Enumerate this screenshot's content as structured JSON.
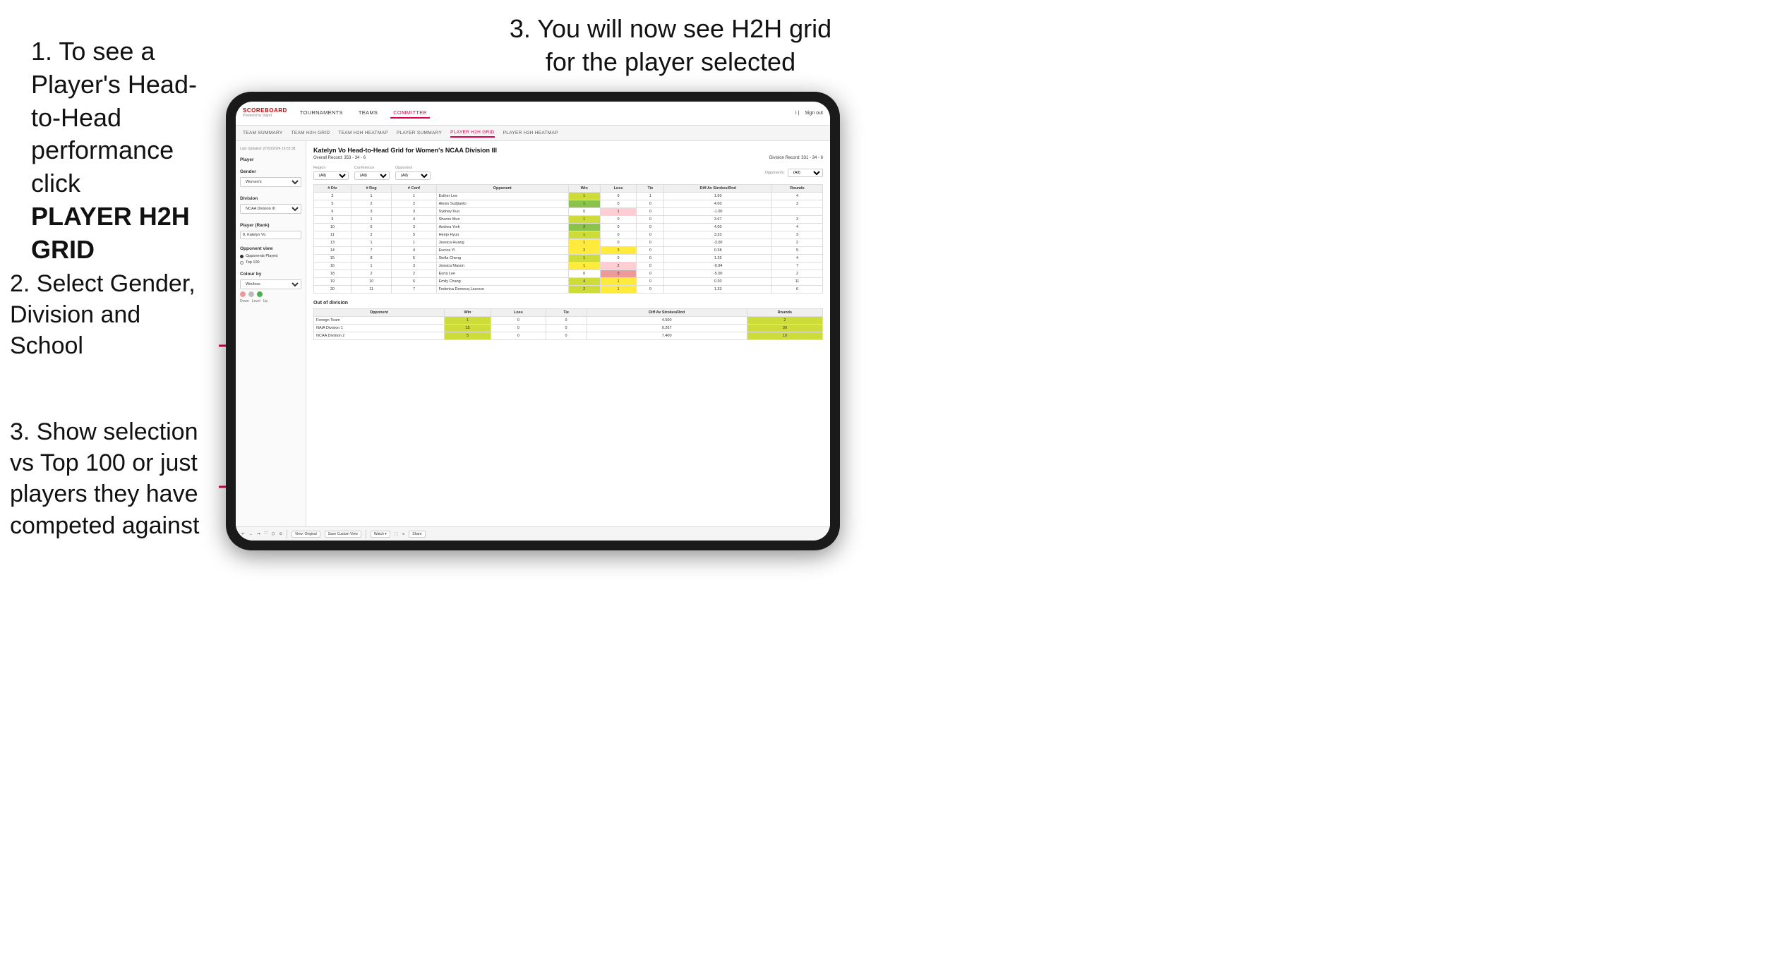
{
  "instructions": {
    "top_left_1": "1. To see a Player's Head-to-Head performance click",
    "top_left_bold": "PLAYER H2H GRID",
    "top_right": "3. You will now see H2H grid for the player selected",
    "left_2": "2. Select Gender, Division and School",
    "left_3_title": "3. Show selection vs Top 100 or just players they have competed against"
  },
  "nav": {
    "logo": "SCOREBOARD",
    "logo_sub": "Powered by clippd",
    "links": [
      "TOURNAMENTS",
      "TEAMS",
      "COMMITTEE"
    ],
    "active_link": "COMMITTEE",
    "sign_out": "Sign out"
  },
  "sub_nav": {
    "links": [
      "TEAM SUMMARY",
      "TEAM H2H GRID",
      "TEAM H2H HEATMAP",
      "PLAYER SUMMARY",
      "PLAYER H2H GRID",
      "PLAYER H2H HEATMAP"
    ],
    "active": "PLAYER H2H GRID"
  },
  "sidebar": {
    "timestamp": "Last Updated: 27/03/2024\n16:55:38",
    "player_label": "Player",
    "gender_label": "Gender",
    "gender_value": "Women's",
    "division_label": "Division",
    "division_value": "NCAA Division III",
    "player_rank_label": "Player (Rank)",
    "player_rank_value": "8. Katelyn Vo",
    "opponent_view_label": "Opponent view",
    "opponent_options": [
      "Opponents Played",
      "Top 100"
    ],
    "opponent_selected": "Opponents Played",
    "colour_by_label": "Colour by",
    "colour_by_value": "Win/loss",
    "colour_legend": [
      "Down",
      "Level",
      "Up"
    ]
  },
  "main": {
    "title": "Katelyn Vo Head-to-Head Grid for Women's NCAA Division III",
    "overall_record": "Overall Record: 353 - 34 - 6",
    "division_record": "Division Record: 331 - 34 - 6",
    "filters": {
      "region_label": "Region",
      "region_value": "(All)",
      "conference_label": "Conference",
      "conference_value": "(All)",
      "opponent_label": "Opponent",
      "opponent_value": "(All)",
      "opponents_label": "Opponents:",
      "opponents_value": "(All)"
    },
    "table_headers": [
      "# Div",
      "# Reg",
      "# Conf",
      "Opponent",
      "Win",
      "Loss",
      "Tie",
      "Diff Av Strokes/Rnd",
      "Rounds"
    ],
    "rows": [
      {
        "div": "3",
        "reg": "1",
        "conf": "1",
        "opponent": "Esther Lee",
        "win": 1,
        "loss": 0,
        "tie": 1,
        "diff": "1.50",
        "rounds": 4,
        "win_class": "cell-green-light",
        "loss_class": "",
        "tie_class": ""
      },
      {
        "div": "5",
        "reg": "2",
        "conf": "2",
        "opponent": "Alexis Sudjianto",
        "win": 1,
        "loss": 0,
        "tie": 0,
        "diff": "4.00",
        "rounds": 3,
        "win_class": "cell-green-med",
        "loss_class": "",
        "tie_class": ""
      },
      {
        "div": "6",
        "reg": "3",
        "conf": "3",
        "opponent": "Sydney Kuo",
        "win": 0,
        "loss": 1,
        "tie": 0,
        "diff": "-1.00",
        "rounds": "",
        "win_class": "",
        "loss_class": "cell-red-light",
        "tie_class": ""
      },
      {
        "div": "9",
        "reg": "1",
        "conf": "4",
        "opponent": "Sharon Mun",
        "win": 1,
        "loss": 0,
        "tie": 0,
        "diff": "3.67",
        "rounds": 3,
        "win_class": "cell-green-light",
        "loss_class": "",
        "tie_class": ""
      },
      {
        "div": "10",
        "reg": "6",
        "conf": "3",
        "opponent": "Andrea York",
        "win": 2,
        "loss": 0,
        "tie": 0,
        "diff": "4.00",
        "rounds": 4,
        "win_class": "cell-green-med",
        "loss_class": "",
        "tie_class": ""
      },
      {
        "div": "11",
        "reg": "2",
        "conf": "5",
        "opponent": "Heejo Hyun",
        "win": 1,
        "loss": 0,
        "tie": 0,
        "diff": "3.33",
        "rounds": 3,
        "win_class": "cell-green-light",
        "loss_class": "",
        "tie_class": ""
      },
      {
        "div": "13",
        "reg": "1",
        "conf": "1",
        "opponent": "Jessica Huang",
        "win": 1,
        "loss": 0,
        "tie": 0,
        "diff": "-3.00",
        "rounds": 2,
        "win_class": "cell-yellow",
        "loss_class": "",
        "tie_class": ""
      },
      {
        "div": "14",
        "reg": "7",
        "conf": "4",
        "opponent": "Eunice Yi",
        "win": 2,
        "loss": 2,
        "tie": 0,
        "diff": "0.38",
        "rounds": 9,
        "win_class": "cell-yellow",
        "loss_class": "cell-yellow",
        "tie_class": ""
      },
      {
        "div": "15",
        "reg": "8",
        "conf": "5",
        "opponent": "Stella Cheng",
        "win": 1,
        "loss": 0,
        "tie": 0,
        "diff": "1.25",
        "rounds": 4,
        "win_class": "cell-green-light",
        "loss_class": "",
        "tie_class": ""
      },
      {
        "div": "16",
        "reg": "1",
        "conf": "3",
        "opponent": "Jessica Mason",
        "win": 1,
        "loss": 2,
        "tie": 0,
        "diff": "-0.94",
        "rounds": 7,
        "win_class": "cell-yellow",
        "loss_class": "cell-red-light",
        "tie_class": ""
      },
      {
        "div": "18",
        "reg": "2",
        "conf": "2",
        "opponent": "Euna Lee",
        "win": 0,
        "loss": 3,
        "tie": 0,
        "diff": "-5.00",
        "rounds": 2,
        "win_class": "",
        "loss_class": "cell-red",
        "tie_class": ""
      },
      {
        "div": "19",
        "reg": "10",
        "conf": "6",
        "opponent": "Emily Chang",
        "win": 4,
        "loss": 1,
        "tie": 0,
        "diff": "0.30",
        "rounds": 11,
        "win_class": "cell-green-light",
        "loss_class": "cell-yellow",
        "tie_class": ""
      },
      {
        "div": "20",
        "reg": "11",
        "conf": "7",
        "opponent": "Federica Domecq Lacroze",
        "win": 2,
        "loss": 1,
        "tie": 0,
        "diff": "1.33",
        "rounds": 6,
        "win_class": "cell-green-light",
        "loss_class": "cell-yellow",
        "tie_class": ""
      }
    ],
    "out_of_division_title": "Out of division",
    "out_of_division_rows": [
      {
        "opponent": "Foreign Team",
        "win": 1,
        "loss": 0,
        "tie": 0,
        "diff": "4.500",
        "rounds": 2
      },
      {
        "opponent": "NAIA Division 1",
        "win": 15,
        "loss": 0,
        "tie": 0,
        "diff": "9.267",
        "rounds": 30
      },
      {
        "opponent": "NCAA Division 2",
        "win": 5,
        "loss": 0,
        "tie": 0,
        "diff": "7.400",
        "rounds": 10
      }
    ]
  },
  "toolbar": {
    "buttons": [
      "↩",
      "←",
      "↪",
      "⛶",
      "↙",
      "⊙",
      "View: Original",
      "Save Custom View",
      "Watch ▾",
      "⬚",
      "≡",
      "Share"
    ]
  }
}
